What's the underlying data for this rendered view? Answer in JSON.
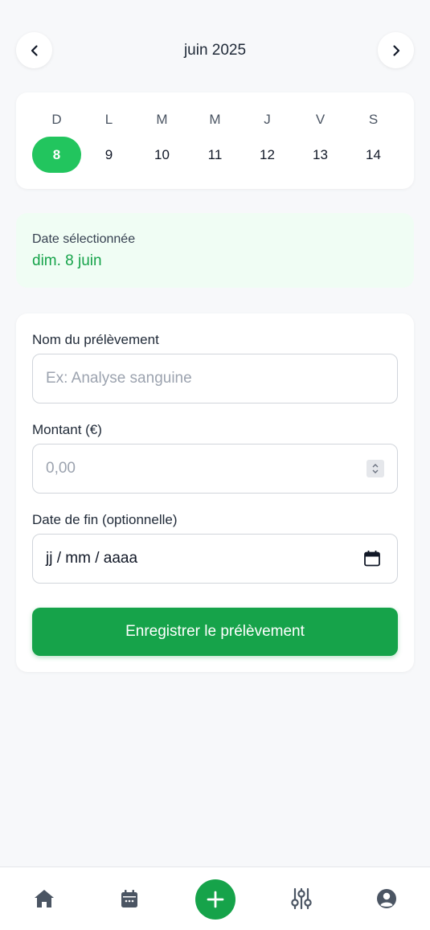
{
  "header": {
    "month_title": "juin 2025",
    "prev_icon": "chevron-left-icon",
    "next_icon": "chevron-right-icon"
  },
  "week": {
    "days": [
      {
        "letter": "D",
        "num": "8",
        "selected": true
      },
      {
        "letter": "L",
        "num": "9",
        "selected": false
      },
      {
        "letter": "M",
        "num": "10",
        "selected": false
      },
      {
        "letter": "M",
        "num": "11",
        "selected": false
      },
      {
        "letter": "J",
        "num": "12",
        "selected": false
      },
      {
        "letter": "V",
        "num": "13",
        "selected": false
      },
      {
        "letter": "S",
        "num": "14",
        "selected": false
      }
    ]
  },
  "selected": {
    "label": "Date sélectionnée",
    "value": "dim. 8 juin"
  },
  "form": {
    "name_label": "Nom du prélèvement",
    "name_placeholder": "Ex: Analyse sanguine",
    "amount_label": "Montant (€)",
    "amount_placeholder": "0,00",
    "end_label": "Date de fin (optionnelle)",
    "end_placeholder": "jj / mm / aaaa",
    "submit_label": "Enregistrer le prélèvement"
  },
  "bottom_nav": {
    "items": [
      "home-icon",
      "calendar-icon",
      "add-icon",
      "sliders-icon",
      "user-circle-icon"
    ]
  },
  "colors": {
    "accent": "#16a34a",
    "selected_day": "#22c55e",
    "selected_bg": "#f0fdf4",
    "background": "#f7f8fa"
  }
}
